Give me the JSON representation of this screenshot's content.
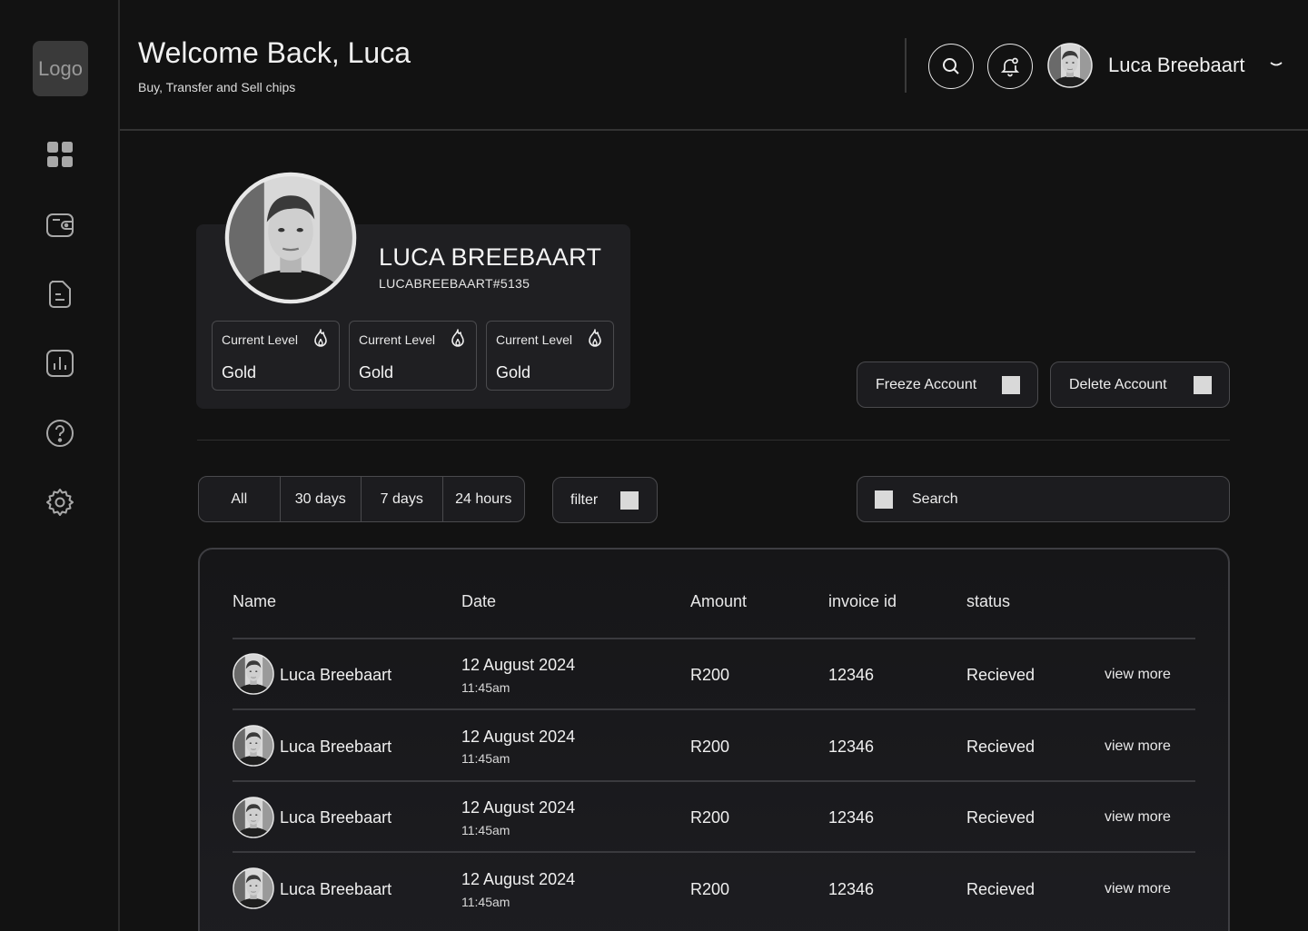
{
  "sidebar": {
    "logo": "Logo",
    "items": [
      {
        "icon": "dashboard-grid-icon"
      },
      {
        "icon": "wallet-icon"
      },
      {
        "icon": "document-icon"
      },
      {
        "icon": "bar-chart-icon"
      },
      {
        "icon": "help-circle-icon"
      },
      {
        "icon": "settings-gear-icon"
      }
    ]
  },
  "header": {
    "title": "Welcome Back, Luca",
    "subtitle": "Buy, Transfer and Sell chips",
    "username": "Luca Breebaart"
  },
  "profile": {
    "name": "LUCA BREEBAART",
    "tag": "LUCABREEBAART#5135",
    "levels": [
      {
        "label": "Current Level",
        "value": "Gold"
      },
      {
        "label": "Current Level",
        "value": "Gold"
      },
      {
        "label": "Current Level",
        "value": "Gold"
      }
    ]
  },
  "account_actions": {
    "freeze": "Freeze Account",
    "delete": "Delete Account"
  },
  "filters": {
    "ranges": [
      "All",
      "30 days",
      "7 days",
      "24 hours"
    ],
    "filter_label": "filter",
    "search_placeholder": "Search"
  },
  "table": {
    "headers": [
      "Name",
      "Date",
      "Amount",
      "invoice id",
      "status"
    ],
    "rows": [
      {
        "name": "Luca Breebaart",
        "date": "12  August 2024",
        "time": "11:45am",
        "amount": "R200",
        "invoice": "12346",
        "status": "Recieved",
        "action": "view more"
      },
      {
        "name": "Luca Breebaart",
        "date": "12  August 2024",
        "time": "11:45am",
        "amount": "R200",
        "invoice": "12346",
        "status": "Recieved",
        "action": "view more"
      },
      {
        "name": "Luca Breebaart",
        "date": "12  August 2024",
        "time": "11:45am",
        "amount": "R200",
        "invoice": "12346",
        "status": "Recieved",
        "action": "view more"
      },
      {
        "name": "Luca Breebaart",
        "date": "12  August 2024",
        "time": "11:45am",
        "amount": "R200",
        "invoice": "12346",
        "status": "Recieved",
        "action": "view more"
      }
    ]
  },
  "colors": {
    "background": "#121212",
    "card": "#1f1f22",
    "border": "#4a4a4d",
    "placeholder_square": "#d9d9d9"
  }
}
